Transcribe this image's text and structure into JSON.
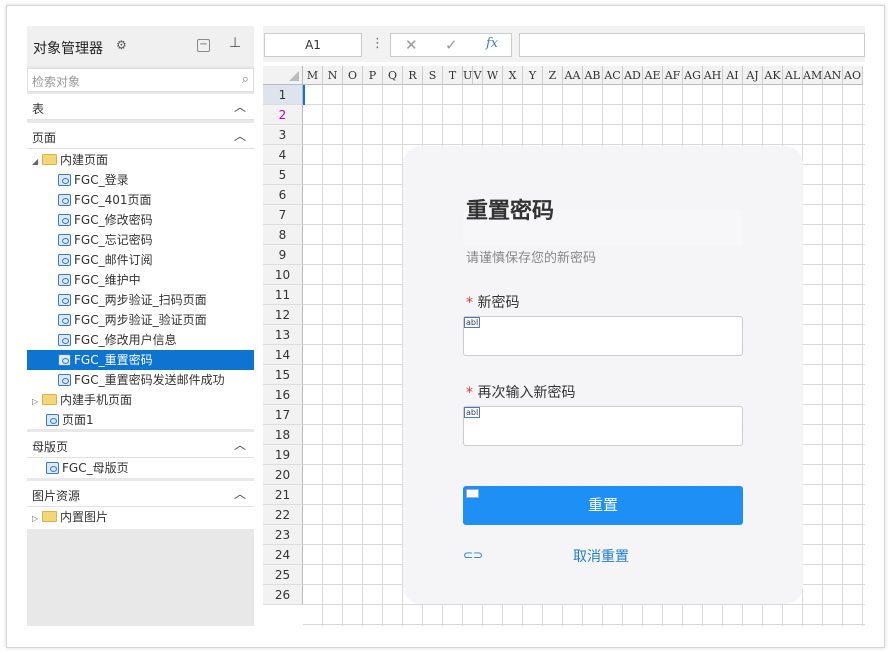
{
  "panel": {
    "title": "对象管理器",
    "search_placeholder": "检索对象"
  },
  "sections": {
    "table": "表",
    "page": "页面",
    "master": "母版页",
    "images": "图片资源"
  },
  "tree": {
    "builtin_pages": "内建页面",
    "pages": [
      "FGC_登录",
      "FGC_401页面",
      "FGC_修改密码",
      "FGC_忘记密码",
      "FGC_邮件订阅",
      "FGC_维护中",
      "FGC_两步验证_扫码页面",
      "FGC_两步验证_验证页面",
      "FGC_修改用户信息",
      "FGC_重置密码",
      "FGC_重置密码发送邮件成功"
    ],
    "selected_index": 9,
    "builtin_mobile": "内建手机页面",
    "page1": "页面1",
    "master_page": "FGC_母版页",
    "builtin_images": "内置图片"
  },
  "toolbar": {
    "cell_ref": "A1",
    "fx": "fx"
  },
  "columns": [
    "M",
    "N",
    "O",
    "P",
    "Q",
    "R",
    "S",
    "T",
    "U",
    "V",
    "W",
    "X",
    "Y",
    "Z",
    "AA",
    "AB",
    "AC",
    "AD",
    "AE",
    "AF",
    "AG",
    "AH",
    "AI",
    "AJ",
    "AK",
    "AL",
    "AM",
    "AN",
    "AO"
  ],
  "rows": [
    "1",
    "2",
    "3",
    "4",
    "5",
    "6",
    "7",
    "8",
    "9",
    "10",
    "11",
    "12",
    "13",
    "14",
    "15",
    "16",
    "17",
    "18",
    "19",
    "20",
    "21",
    "22",
    "23",
    "24",
    "25",
    "26"
  ],
  "form": {
    "title": "重置密码",
    "subtitle": "请谨慎保存您的新密码",
    "label_new": "新密码",
    "label_confirm": "再次输入新密码",
    "required_mark": "*",
    "input_tag": "abl",
    "submit": "重置",
    "cancel": "取消重置"
  }
}
